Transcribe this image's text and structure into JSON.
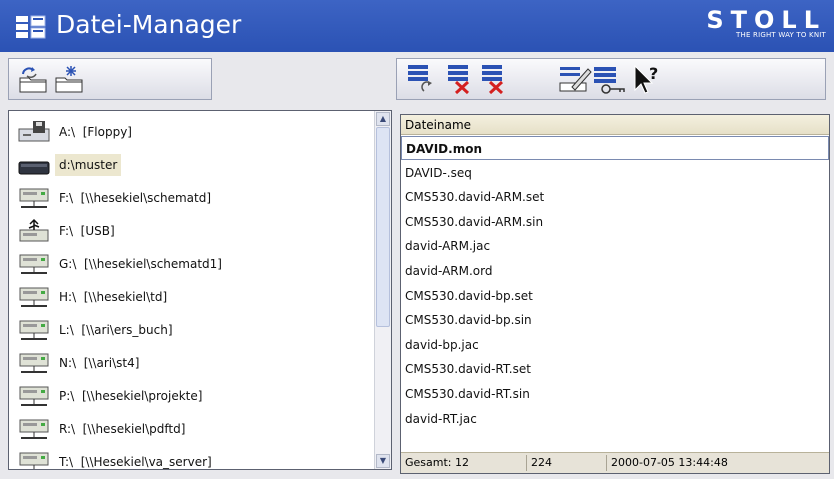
{
  "window": {
    "title": "Datei-Manager"
  },
  "brand": {
    "name": "STOLL",
    "tagline": "THE RIGHT WAY TO KNIT"
  },
  "toolbar_left": [
    {
      "icon": "folder-refresh-icon"
    },
    {
      "icon": "folder-new-icon"
    }
  ],
  "toolbar_right": [
    {
      "icon": "list-refresh-icon"
    },
    {
      "icon": "list-delete-icon"
    },
    {
      "icon": "list-delete-all-icon"
    },
    {
      "icon": "rename-icon"
    },
    {
      "icon": "list-key-icon"
    },
    {
      "icon": "help-icon"
    }
  ],
  "drives": [
    {
      "label": "A:\\  [Floppy]",
      "icon": "floppy-drive-icon"
    },
    {
      "label": "d:\\muster",
      "icon": "hard-drive-icon",
      "selected": true
    },
    {
      "label": "F:\\  [\\\\hesekiel\\schematd]",
      "icon": "network-drive-icon"
    },
    {
      "label": "F:\\  [USB]",
      "icon": "usb-drive-icon"
    },
    {
      "label": "G:\\  [\\\\hesekiel\\schematd1]",
      "icon": "network-drive-icon"
    },
    {
      "label": "H:\\  [\\\\hesekiel\\td]",
      "icon": "network-drive-icon"
    },
    {
      "label": "L:\\  [\\\\ari\\ers_buch]",
      "icon": "network-drive-icon"
    },
    {
      "label": "N:\\  [\\\\ari\\st4]",
      "icon": "network-drive-icon"
    },
    {
      "label": "P:\\  [\\\\hesekiel\\projekte]",
      "icon": "network-drive-icon"
    },
    {
      "label": "R:\\  [\\\\hesekiel\\pdftd]",
      "icon": "network-drive-icon"
    },
    {
      "label": "T:\\  [\\\\Hesekiel\\va_server]",
      "icon": "network-drive-icon"
    }
  ],
  "files": {
    "header": "Dateiname",
    "rows": [
      "DAVID.mon",
      "DAVID-.seq",
      "CMS530.david-ARM.set",
      "CMS530.david-ARM.sin",
      "david-ARM.jac",
      "david-ARM.ord",
      "CMS530.david-bp.set",
      "CMS530.david-bp.sin",
      "david-bp.jac",
      "CMS530.david-RT.set",
      "CMS530.david-RT.sin",
      "david-RT.jac"
    ],
    "selected_index": 0,
    "status": {
      "total_label": "Gesamt:  12",
      "size": "224",
      "datetime": "2000-07-05 13:44:48"
    }
  },
  "colors": {
    "titlebar": "#2f56b8",
    "selection": "#ece7cf"
  }
}
